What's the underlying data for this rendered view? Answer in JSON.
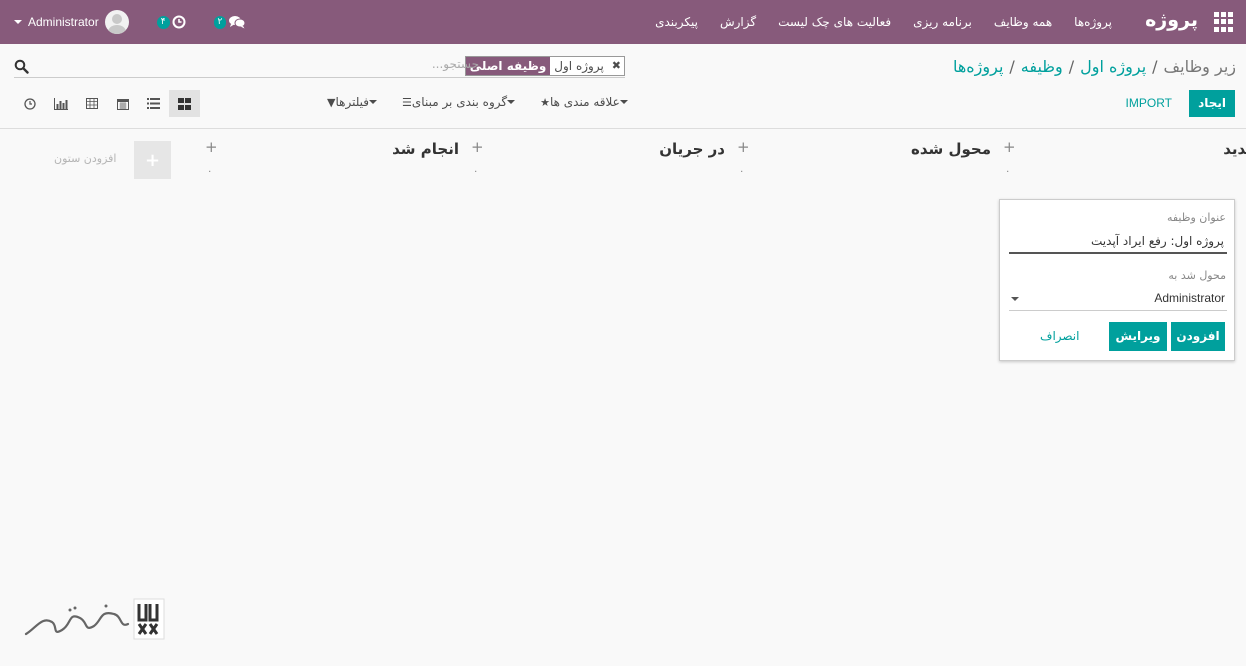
{
  "navbar": {
    "brand": "پروژه",
    "menu": [
      "پروژه‌ها",
      "همه وظایف",
      "برنامه ریزی",
      "فعالیت های چک لیست",
      "گزارش",
      "پیکربندی"
    ],
    "user_name": "Administrator",
    "activity_count": "۴",
    "message_count": "۲"
  },
  "breadcrumb": {
    "items": [
      "پروژه‌ها",
      "وظیفه",
      "پروژه اول"
    ],
    "separator": "/",
    "active": "زیر وظایف"
  },
  "search": {
    "facet_category": "وظیفه اصلی",
    "facet_value": "پروژه اول",
    "placeholder": "جستجو..."
  },
  "buttons": {
    "create": "ایجاد",
    "import": "IMPORT"
  },
  "search_options": {
    "filters": "فیلترها",
    "group_by": "گروه بندی بر مبنای",
    "favorites": "علاقه مندی ها"
  },
  "views": [
    "kanban",
    "list",
    "calendar",
    "pivot",
    "graph",
    "activity"
  ],
  "kanban": {
    "columns": [
      {
        "title": "جدید",
        "count": "۰"
      },
      {
        "title": "محول شده",
        "count": "۰"
      },
      {
        "title": "در جریان",
        "count": "۰"
      },
      {
        "title": "انجام شد",
        "count": "۰"
      }
    ],
    "add_column": "افزودن ستون"
  },
  "quick_create": {
    "title_label": "عنوان وظیفه",
    "title_value": "پروژه اول: رفع ایراد آپدیت",
    "assigned_label": "محول شد به",
    "assigned_value": "Administrator",
    "add": "افزودن",
    "edit": "ویرایش",
    "discard": "انصراف"
  },
  "colors": {
    "brand": "#875a7b",
    "accent": "#00a09d"
  }
}
